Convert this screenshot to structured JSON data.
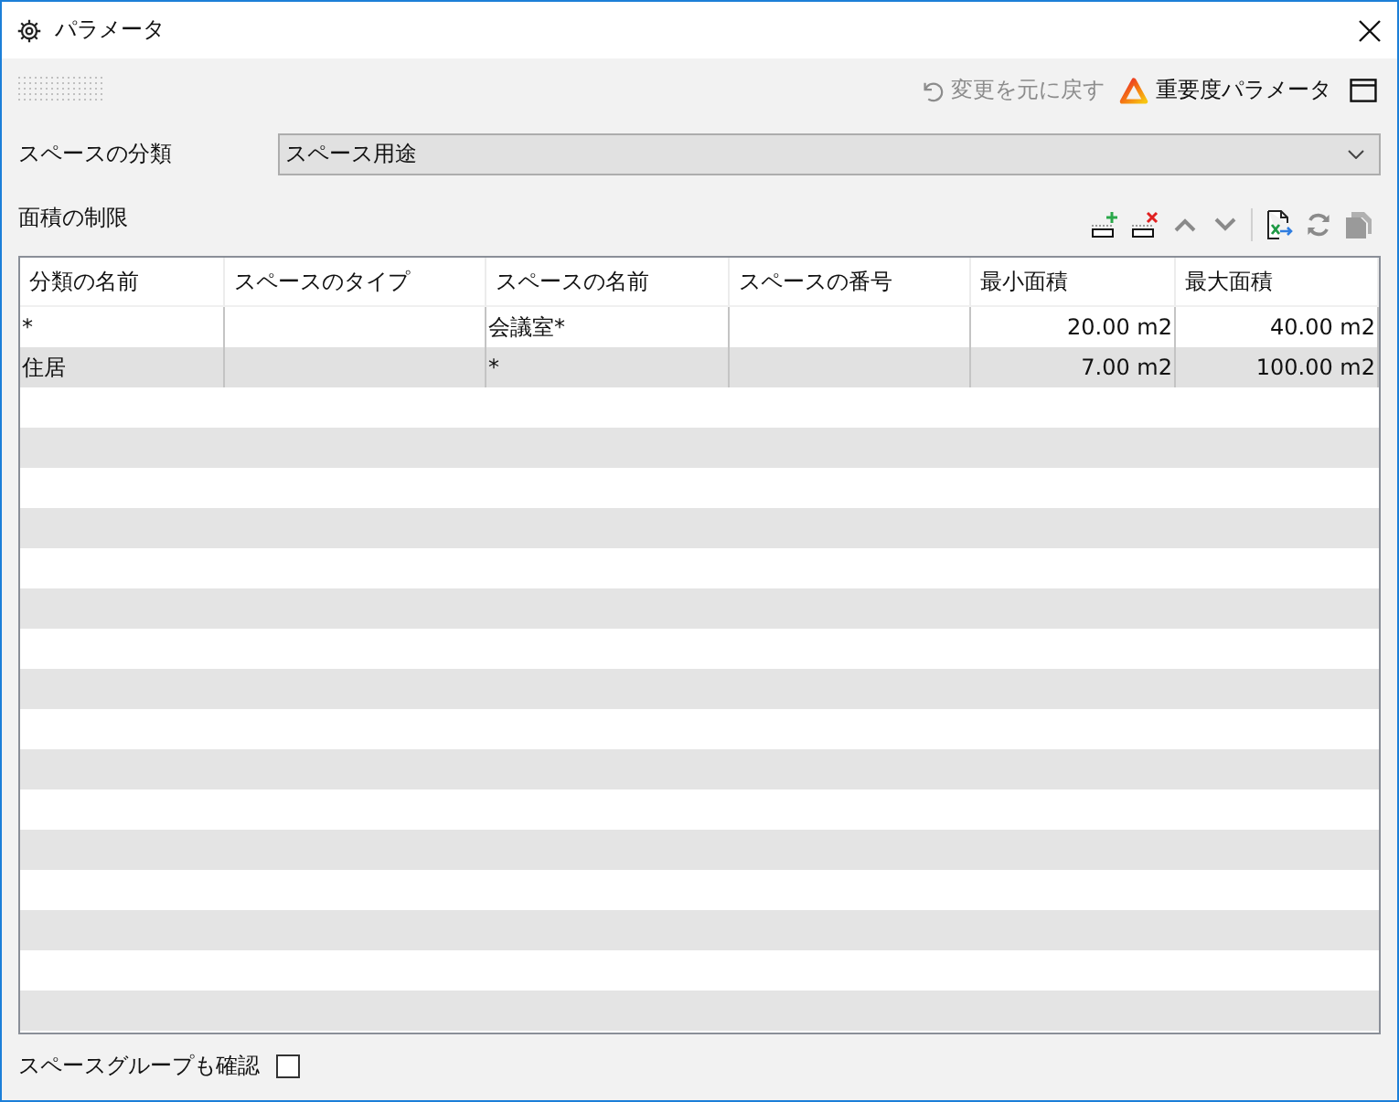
{
  "window": {
    "title": "パラメータ"
  },
  "toolbar": {
    "undo": {
      "label": "変更を元に戻す",
      "disabled": true
    },
    "importance": {
      "label": "重要度パラメータ"
    }
  },
  "classification": {
    "label": "スペースの分類",
    "value": "スペース用途"
  },
  "area_limits": {
    "title": "面積の制限",
    "actions": [
      {
        "kind": "add-row"
      },
      {
        "kind": "delete-row"
      },
      {
        "kind": "move-up"
      },
      {
        "kind": "move-down"
      },
      {
        "kind": "separator"
      },
      {
        "kind": "export"
      },
      {
        "kind": "refresh"
      },
      {
        "kind": "import"
      }
    ],
    "table": {
      "columns": [
        {
          "label": "分類の名前",
          "kind": "text"
        },
        {
          "label": "スペースのタイプ",
          "kind": "text"
        },
        {
          "label": "スペースの名前",
          "kind": "text"
        },
        {
          "label": "スペースの番号",
          "kind": "text"
        },
        {
          "label": "最小面積",
          "kind": "number"
        },
        {
          "label": "最大面積",
          "kind": "number"
        }
      ],
      "rows": [
        {
          "cells": [
            "*",
            null,
            "会議室*",
            null,
            "20.00 m2",
            "40.00 m2"
          ]
        },
        {
          "cells": [
            "住居",
            null,
            "*",
            null,
            "7.00 m2",
            "100.00 m2"
          ]
        }
      ]
    }
  },
  "check_space_groups": {
    "label": "スペースグループも確認",
    "checked": false
  }
}
